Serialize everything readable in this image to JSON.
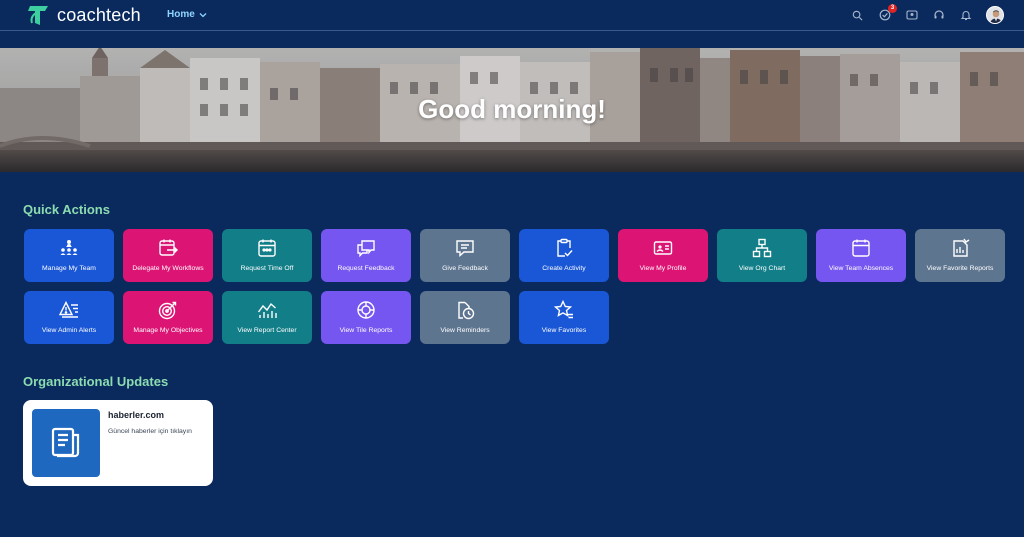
{
  "header": {
    "brand": "coachtech",
    "nav_label": "Home",
    "notification_count": "3"
  },
  "banner": {
    "greeting": "Good morning!"
  },
  "quick_actions": {
    "title": "Quick Actions",
    "tiles": [
      {
        "label": "Manage My Team",
        "icon": "team-hierarchy-icon",
        "color": "#1a57d6"
      },
      {
        "label": "Delegate My Workflows",
        "icon": "calendar-forward-icon",
        "color": "#dc1575"
      },
      {
        "label": "Request Time Off",
        "icon": "calendar-icon",
        "color": "#127e88"
      },
      {
        "label": "Request Feedback",
        "icon": "chat-bubbles-icon",
        "color": "#7656f0"
      },
      {
        "label": "Give Feedback",
        "icon": "comment-icon",
        "color": "#5e7590"
      },
      {
        "label": "Create Activity",
        "icon": "clipboard-check-icon",
        "color": "#1a57d6"
      },
      {
        "label": "View My Profile",
        "icon": "id-card-icon",
        "color": "#dc1575"
      },
      {
        "label": "View Org Chart",
        "icon": "org-chart-icon",
        "color": "#127e88"
      },
      {
        "label": "View Team Absences",
        "icon": "calendar-icon",
        "color": "#7656f0"
      },
      {
        "label": "View Favorite Reports",
        "icon": "report-chart-icon",
        "color": "#5e7590"
      },
      {
        "label": "View Admin Alerts",
        "icon": "alert-list-icon",
        "color": "#1a57d6"
      },
      {
        "label": "Manage My Objectives",
        "icon": "target-icon",
        "color": "#dc1575"
      },
      {
        "label": "View Report Center",
        "icon": "line-chart-icon",
        "color": "#127e88"
      },
      {
        "label": "View Tile Reports",
        "icon": "tile-report-icon",
        "color": "#7656f0"
      },
      {
        "label": "View Reminders",
        "icon": "reminder-icon",
        "color": "#5e7590"
      },
      {
        "label": "View Favorites",
        "icon": "star-list-icon",
        "color": "#1a57d6"
      }
    ]
  },
  "org_updates": {
    "title": "Organizational Updates",
    "card": {
      "name": "haberler.com",
      "description": "Güncel haberler için tıklayın",
      "icon": "news-document-icon"
    }
  }
}
